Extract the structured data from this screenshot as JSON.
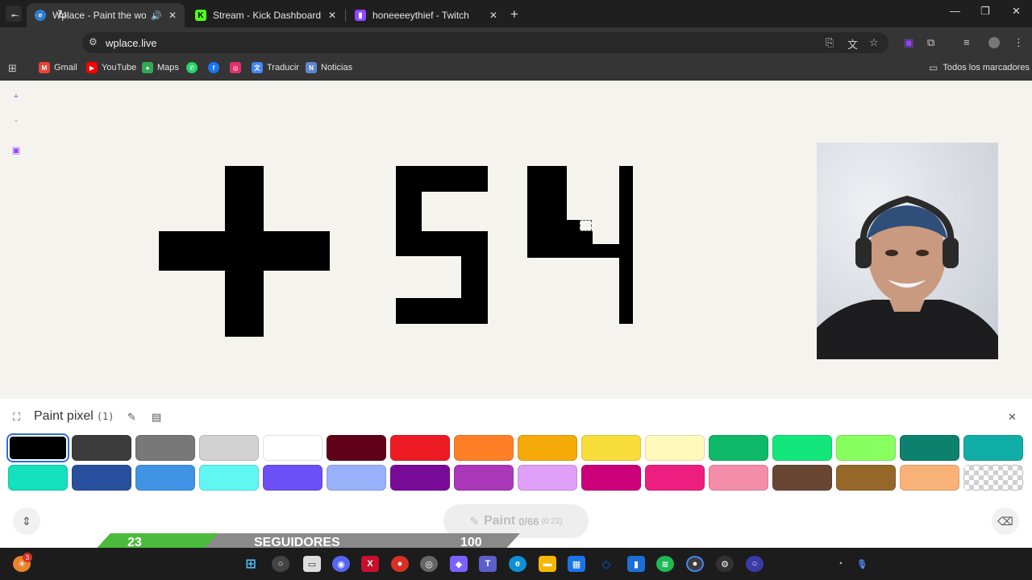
{
  "browser": {
    "tabs": [
      {
        "title": "Wplace - Paint the world",
        "active": true
      },
      {
        "title": "Stream - Kick Dashboard",
        "active": false
      },
      {
        "title": "honeeeeythief - Twitch",
        "active": false
      }
    ],
    "url": "wplace.live",
    "bookmarks": [
      {
        "label": "Gmail",
        "color": "#ea4335",
        "glyph": "M"
      },
      {
        "label": "YouTube",
        "color": "#ff0000",
        "glyph": "▶"
      },
      {
        "label": "Maps",
        "color": "#34a853",
        "glyph": "●"
      },
      {
        "label": "",
        "color": "#25d366",
        "glyph": "✆"
      },
      {
        "label": "",
        "color": "#1877f2",
        "glyph": "f"
      },
      {
        "label": "",
        "color": "#e1306c",
        "glyph": "◎"
      },
      {
        "label": "Traducir",
        "color": "#4285f4",
        "glyph": "文"
      },
      {
        "label": "Noticias",
        "color": "#5f86c9",
        "glyph": "N"
      }
    ],
    "all_bookmarks_label": "Todos los marcadores"
  },
  "canvas": {
    "side_buttons": [
      "+",
      "-"
    ]
  },
  "panel": {
    "title": "Paint pixel",
    "count": "(1)",
    "palette": [
      "#000000",
      "#3c3c3c",
      "#787878",
      "#d2d2d2",
      "#ffffff",
      "#600018",
      "#ed1c24",
      "#ff7f27",
      "#f6aa09",
      "#f9dd3b",
      "#fffabc",
      "#0eb968",
      "#13e67b",
      "#87ff5e",
      "#0c816e",
      "#10aea6",
      "#13e1be",
      "#28509e",
      "#4093e4",
      "#60f7f2",
      "#6b50f6",
      "#99b1fb",
      "#780c99",
      "#aa38b9",
      "#e09ff9",
      "#cb007a",
      "#ec1f80",
      "#f38da9",
      "#684634",
      "#95682a",
      "#f8b277",
      "transparent"
    ],
    "selected_index": 0,
    "paint_label": "Paint",
    "paint_progress": "0/66",
    "paint_timer": "(0:22)"
  },
  "overlay": {
    "current": "23",
    "label": "SEGUIDORES",
    "goal": "100",
    "progress": 0.23
  },
  "taskbar": {
    "notification_count": "3"
  }
}
